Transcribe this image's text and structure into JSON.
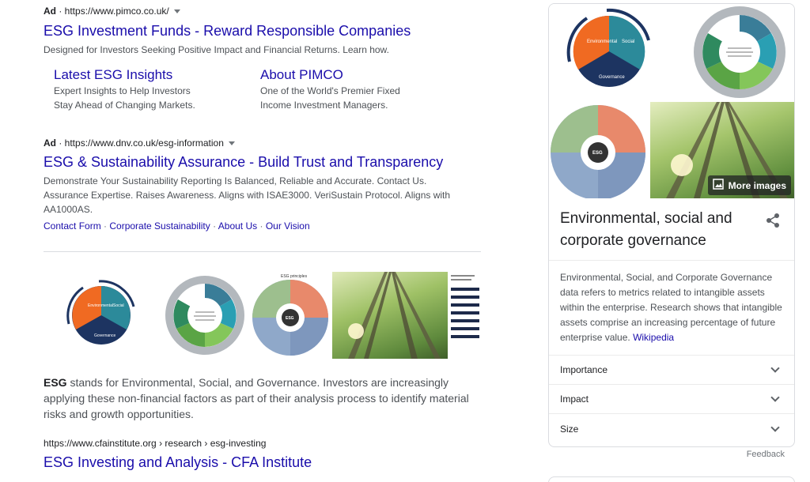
{
  "ad1": {
    "label": "Ad",
    "url": "https://www.pimco.co.uk/",
    "title": "ESG Investment Funds - Reward Responsible Companies",
    "description": "Designed for Investors Seeking Positive Impact and Financial Returns. Learn how.",
    "sitelinks": [
      {
        "title": "Latest ESG Insights",
        "line1": "Expert Insights to Help Investors",
        "line2": "Stay Ahead of Changing Markets."
      },
      {
        "title": "About PIMCO",
        "line1": "One of the World's Premier Fixed",
        "line2": "Income Investment Managers."
      }
    ]
  },
  "ad2": {
    "label": "Ad",
    "url": "https://www.dnv.co.uk/esg-information",
    "title": "ESG & Sustainability Assurance - Build Trust and Transparency",
    "description": "Demonstrate Your Sustainability Reporting Is Balanced, Reliable and Accurate. Contact Us. Assurance Expertise. Raises Awareness. Aligns with ISAE3000. VeriSustain Protocol. Aligns with AA1000AS.",
    "links": [
      "Contact Form",
      "Corporate Sustainability",
      "About Us",
      "Our Vision"
    ]
  },
  "images": {
    "esg_pie_labels": [
      "Environmental",
      "Social",
      "Governance"
    ],
    "esg_principles_title": "ESG principles",
    "esg_center": "ESG"
  },
  "featured": {
    "term": "ESG",
    "text": " stands for Environmental, Social, and Governance. Investors are increasingly applying these non-financial factors as part of their analysis process to identify material risks and growth opportunities.",
    "cite": "https://www.cfainstitute.org › research › esg-investing",
    "title": "ESG Investing and Analysis - CFA Institute"
  },
  "knowledge_panel": {
    "more_images": "More images",
    "title": "Environmental, social and corporate governance",
    "description": "Environmental, Social, and Corporate Governance data refers to metrics related to intangible assets within the enterprise. Research shows that intangible assets comprise an increasing percentage of future enterprise value.",
    "source": "Wikipedia",
    "accordions": [
      "Importance",
      "Impact",
      "Size"
    ],
    "feedback": "Feedback"
  },
  "colors": {
    "link": "#1a0dab",
    "env_orange": "#f06a22",
    "social_teal": "#2c8a9a",
    "gov_navy": "#1d3461",
    "forest_green": "#6f9a4a"
  },
  "icons": [
    "caret-down-icon",
    "share-icon",
    "image-icon",
    "chevron-down-icon"
  ]
}
